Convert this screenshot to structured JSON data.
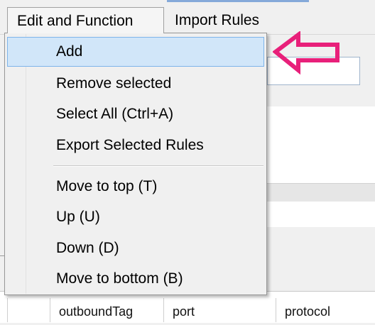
{
  "menubar": {
    "items": [
      {
        "label": "Edit and Function",
        "open": true
      },
      {
        "label": "Import Rules",
        "open": false
      }
    ]
  },
  "dropdown": {
    "items": [
      {
        "label": "Add",
        "highlighted": true
      },
      {
        "label": "Remove selected"
      },
      {
        "label": "Select All (Ctrl+A)"
      },
      {
        "label": "Export Selected Rules"
      },
      {
        "label": "Move to top (T)"
      },
      {
        "label": "Up (U)"
      },
      {
        "label": "Down (D)"
      },
      {
        "label": "Move to bottom (B)"
      }
    ]
  },
  "table": {
    "columns": [
      "",
      "outboundTag",
      "port",
      "protocol"
    ]
  },
  "annotation": {
    "arrow_color": "#e8207a",
    "points_to": "Add"
  },
  "colors": {
    "highlight_bg": "#d1e6f9",
    "highlight_border": "#7eb4ea",
    "arrow": "#e8207a"
  }
}
